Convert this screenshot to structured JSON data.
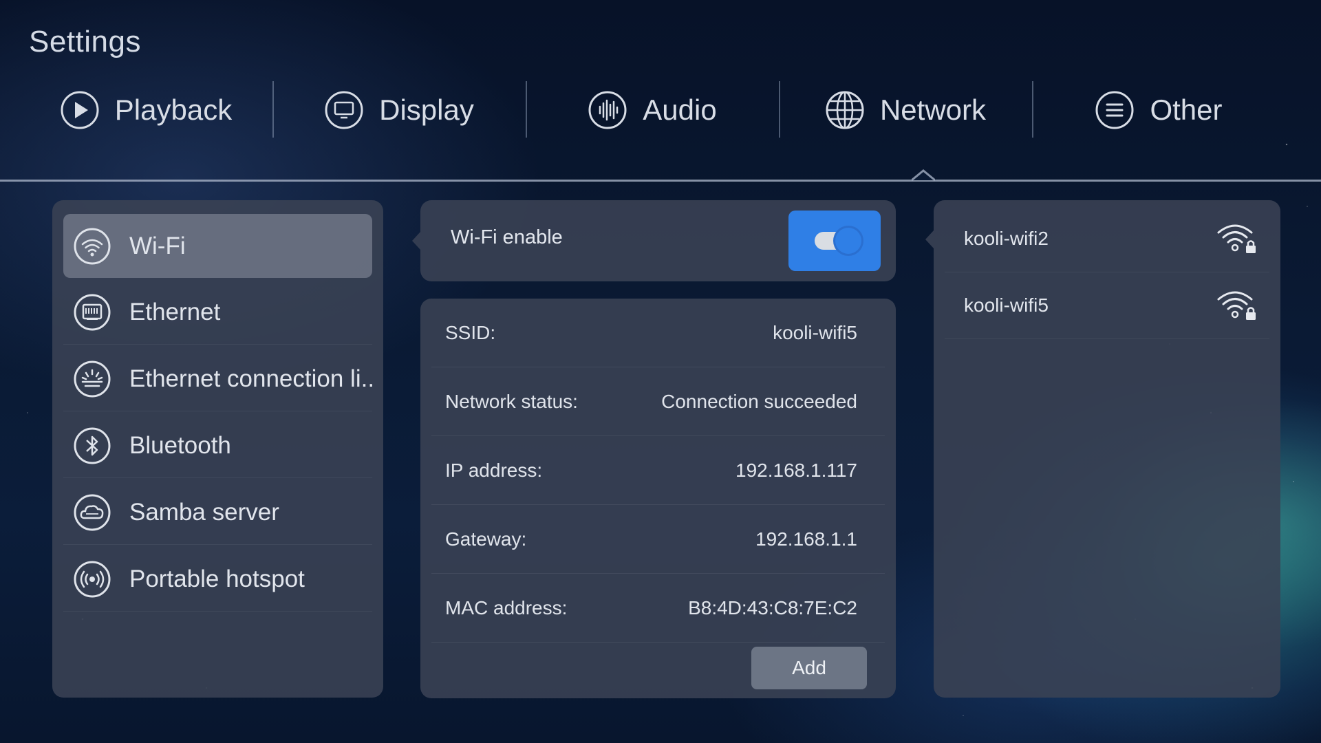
{
  "page_title": "Settings",
  "tabs": [
    {
      "label": "Playback",
      "icon": "play-circle-icon"
    },
    {
      "label": "Display",
      "icon": "monitor-icon"
    },
    {
      "label": "Audio",
      "icon": "audio-wave-icon"
    },
    {
      "label": "Network",
      "icon": "globe-icon",
      "selected": true
    },
    {
      "label": "Other",
      "icon": "menu-lines-icon"
    }
  ],
  "sidebar": {
    "items": [
      {
        "label": "Wi-Fi",
        "icon": "wifi-icon",
        "selected": true
      },
      {
        "label": "Ethernet",
        "icon": "ethernet-port-icon"
      },
      {
        "label": "Ethernet connection li..",
        "icon": "ethernet-light-icon"
      },
      {
        "label": "Bluetooth",
        "icon": "bluetooth-icon"
      },
      {
        "label": "Samba server",
        "icon": "samba-cloud-icon"
      },
      {
        "label": "Portable hotspot",
        "icon": "hotspot-icon"
      }
    ]
  },
  "wifi_toggle": {
    "label": "Wi-Fi enable",
    "enabled": true,
    "accent_color": "#2f7fe6"
  },
  "info": {
    "rows": [
      {
        "label": "SSID:",
        "value": "kooli-wifi5"
      },
      {
        "label": "Network status:",
        "value": "Connection succeeded"
      },
      {
        "label": "IP address:",
        "value": "192.168.1.117"
      },
      {
        "label": "Gateway:",
        "value": "192.168.1.1"
      },
      {
        "label": "MAC address:",
        "value": "B8:4D:43:C8:7E:C2"
      }
    ],
    "add_label": "Add"
  },
  "networks": [
    {
      "name": "kooli-wifi2",
      "icon": "wifi-locked-icon"
    },
    {
      "name": "kooli-wifi5",
      "icon": "wifi-locked-icon"
    }
  ]
}
